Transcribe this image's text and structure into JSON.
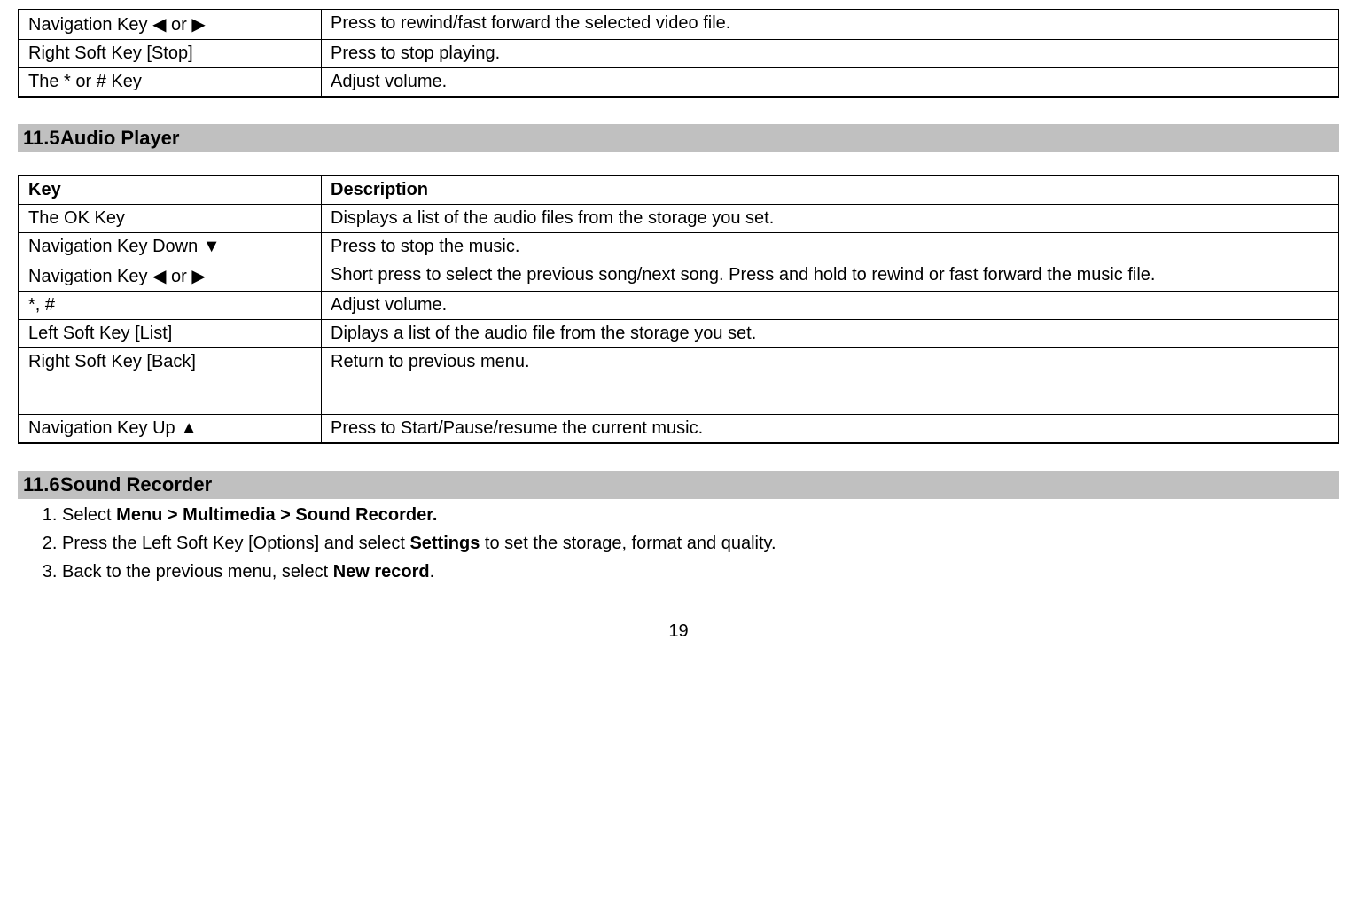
{
  "topTable": {
    "rows": [
      {
        "key": "Navigation Key  ◀  or  ▶",
        "desc": "Press to rewind/fast forward the selected video file."
      },
      {
        "key": "Right Soft Key [Stop]",
        "desc": "Press to stop playing."
      },
      {
        "key": "The * or # Key",
        "desc": "Adjust volume."
      }
    ]
  },
  "section_audio": {
    "number": "11.5",
    "title": "Audio Player",
    "header_key": "Key",
    "header_desc": "Description",
    "rows": [
      {
        "key": "The OK Key",
        "desc": "Displays a list of the audio files from the storage you set."
      },
      {
        "key": "Navigation Key Down ▼",
        "desc": "Press to stop the music."
      },
      {
        "key": "Navigation Key  ◀  or  ▶",
        "desc": "Short press to select the previous song/next song. Press and hold to rewind or fast forward the music file."
      },
      {
        "key": "*, #",
        "desc": "Adjust volume."
      },
      {
        "key": "Left Soft Key [List]",
        "desc": "Diplays a list of the audio file from the storage you set."
      },
      {
        "key": "Right Soft Key [Back]",
        "desc": "Return to previous menu."
      },
      {
        "key": "Navigation Key Up ▲",
        "desc": "Press to Start/Pause/resume the current music."
      }
    ]
  },
  "section_recorder": {
    "number": "11.6",
    "title": "Sound Recorder",
    "steps": {
      "s1_pre": "Select ",
      "s1_bold": "Menu > Multimedia > Sound Recorder.",
      "s2_pre": "Press the Left Soft Key [Options] and select ",
      "s2_bold": "Settings",
      "s2_post": " to set the storage, format and quality.",
      "s3_pre": "Back to the previous menu, select ",
      "s3_bold": "New record",
      "s3_post": "."
    }
  },
  "page_number": "19"
}
